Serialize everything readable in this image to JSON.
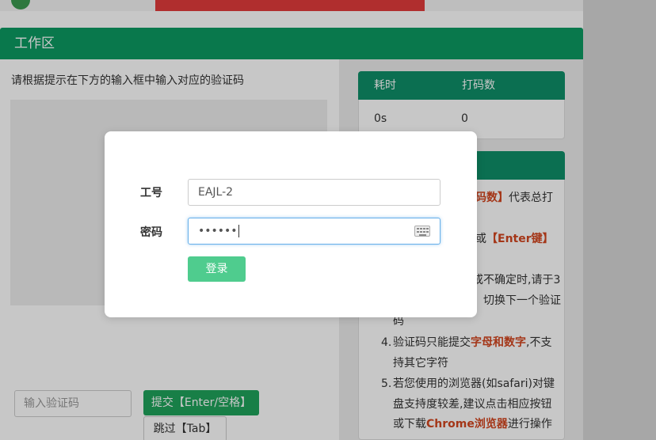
{
  "workarea": {
    "title": "工作区",
    "instruction": "请根据提示在下方的输入框中输入对应的验证码"
  },
  "captcha": {
    "input_placeholder": "输入验证码",
    "submit_label": "提交【Enter/空格】",
    "skip_label": "跳过【Tab】"
  },
  "stats": {
    "col1_header": "耗时",
    "col2_header": "打码数",
    "col1_value": "0s",
    "col2_value": "0"
  },
  "tips": {
    "t1_red": "码数】",
    "t1_text": "代表总打",
    "t2_prefix": "或",
    "t2_red": "【Enter键】",
    "t3_line1": "或不确定时,请于3",
    "t3_line2": "，切换下一个验证",
    "t3_line3": "码",
    "t4_num": "4.",
    "t4_text1": "验证码只能提交",
    "t4_red": "字母和数字",
    "t4_text2": ",不支",
    "t4_line2": "持其它字符",
    "t5_num": "5.",
    "t5_line1": "若您使用的浏览器(如safari)对键",
    "t5_line2": "盘支持度较差,建议点击相应按钮",
    "t5_line3_a": "或下载",
    "t5_line3_red": "Chrome浏览器",
    "t5_line3_b": "进行操作"
  },
  "login_modal": {
    "id_label": "工号",
    "id_value": "EAJL-2",
    "password_label": "密码",
    "password_value": "••••••",
    "login_label": "登录"
  },
  "colors": {
    "header_green": "#0c9a62",
    "button_green": "#1fa35b",
    "login_green": "#4fcc8e",
    "accent_red": "#d3461f"
  }
}
